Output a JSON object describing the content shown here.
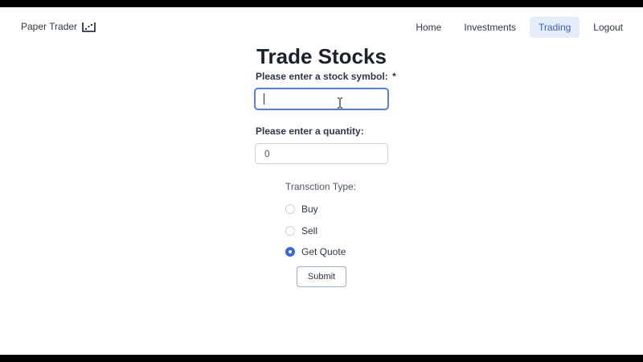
{
  "brand": {
    "name": "Paper Trader",
    "icon": "chart-icon"
  },
  "nav": {
    "items": [
      {
        "label": "Home"
      },
      {
        "label": "Investments"
      },
      {
        "label": "Trading",
        "active": true
      },
      {
        "label": "Logout"
      }
    ]
  },
  "page": {
    "title": "Trade Stocks"
  },
  "form": {
    "symbol_label": "Please enter a stock symbol:",
    "symbol_required_mark": "*",
    "symbol_value": "",
    "quantity_label": "Please enter a quantity:",
    "quantity_value": "0",
    "transaction_type_label": "Transction Type:",
    "options": [
      {
        "label": "Buy",
        "checked": false
      },
      {
        "label": "Sell",
        "checked": false
      },
      {
        "label": "Get Quote",
        "checked": true
      }
    ],
    "submit_label": "Submit"
  },
  "colors": {
    "accent": "#3b66d6",
    "active_nav_bg": "#e6edfa",
    "active_nav_text": "#3b5bb5"
  }
}
